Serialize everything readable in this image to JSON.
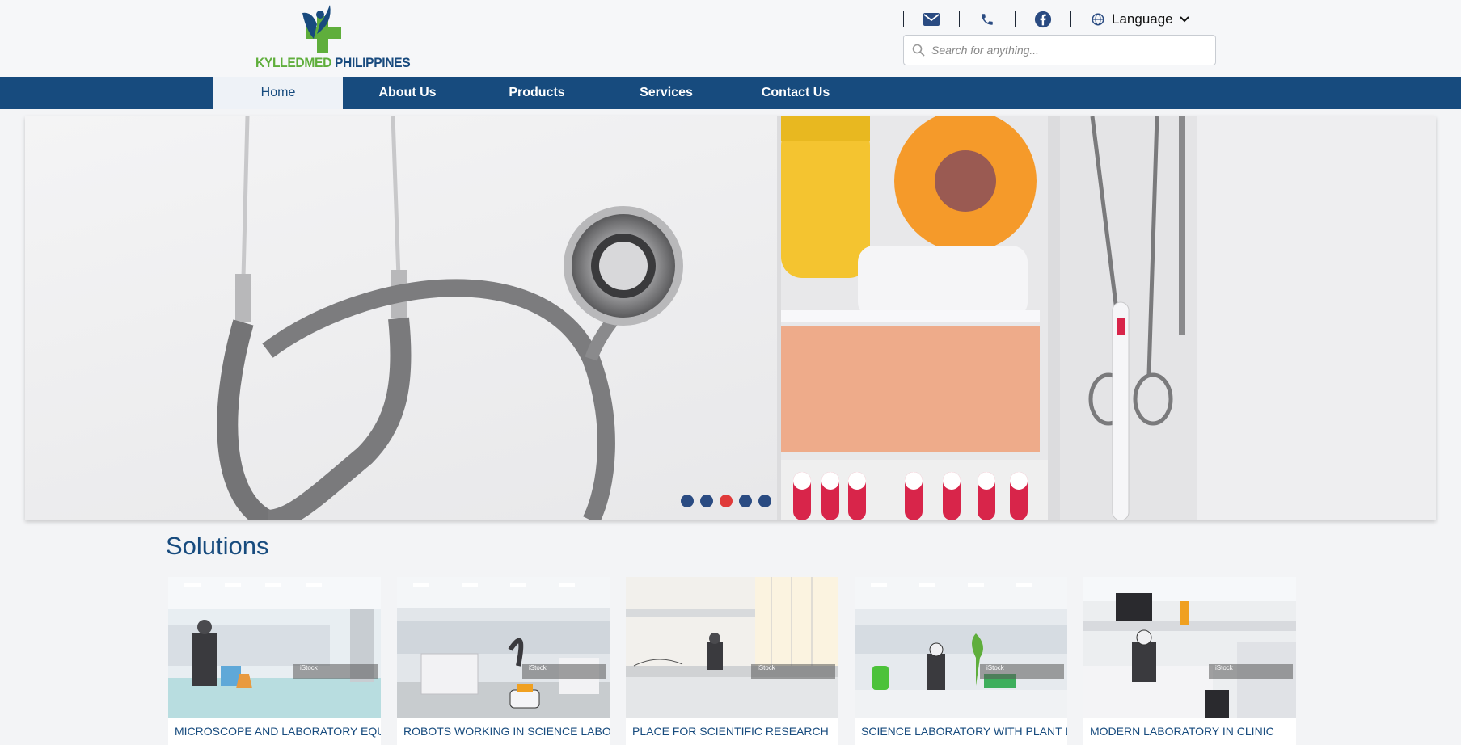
{
  "brand": {
    "name_green": "KYLLEDMED",
    "name_blue": "PHILIPPINES"
  },
  "topbar": {
    "icons": [
      "mail-icon",
      "phone-icon",
      "facebook-icon"
    ],
    "language_label": "Language",
    "search_placeholder": "Search for anything..."
  },
  "nav": {
    "items": [
      {
        "label": "Home",
        "active": true
      },
      {
        "label": "About Us",
        "active": false
      },
      {
        "label": "Products",
        "active": false
      },
      {
        "label": "Services",
        "active": false
      },
      {
        "label": "Contact Us",
        "active": false
      }
    ]
  },
  "hero": {
    "slide_count": 5,
    "active_slide": 3
  },
  "solutions": {
    "title": "Solutions",
    "cards": [
      {
        "caption": "MICROSCOPE AND LABORATORY EQUIPMENT",
        "watermark": "iStock"
      },
      {
        "caption": "ROBOTS WORKING IN SCIENCE LABORATORY",
        "watermark": "iStock"
      },
      {
        "caption": "PLACE FOR SCIENTIFIC RESEARCH",
        "watermark": "iStock"
      },
      {
        "caption": "SCIENCE LABORATORY WITH PLANT LEAVES",
        "watermark": "iStock"
      },
      {
        "caption": "MODERN LABORATORY IN CLINIC",
        "watermark": "iStock"
      }
    ]
  },
  "colors": {
    "primary": "#174b7e",
    "accent_green": "#5fae3c",
    "dot_active": "#e03a3a",
    "dot": "#2a4b82"
  }
}
